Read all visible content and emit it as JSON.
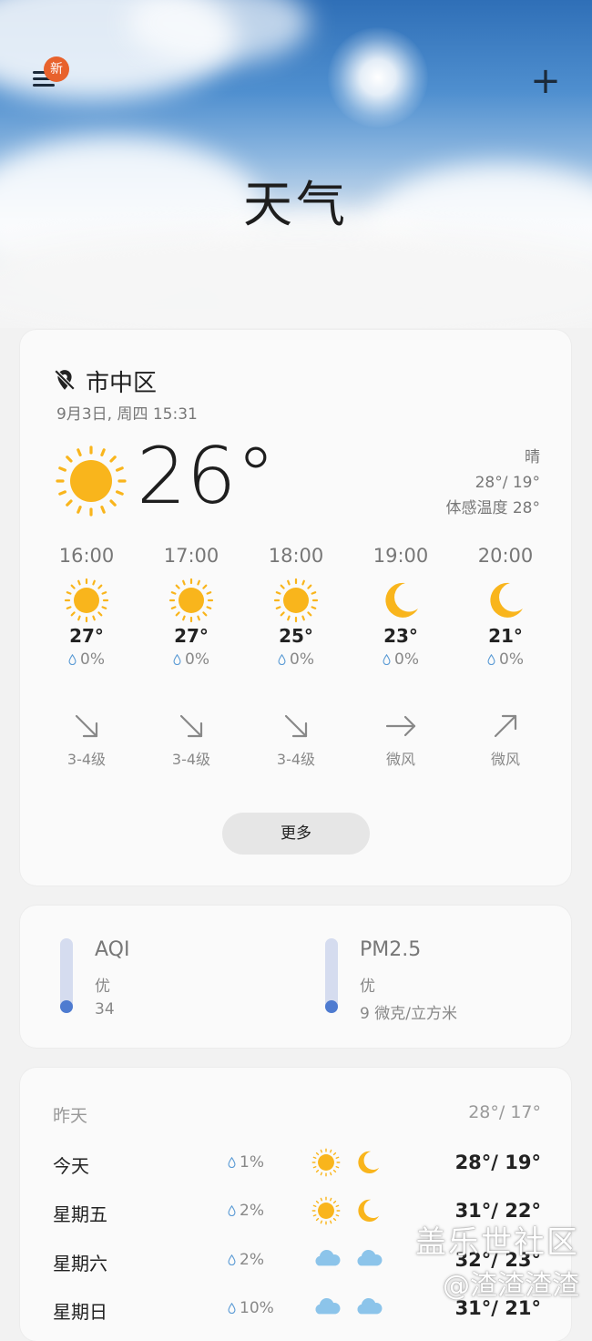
{
  "header": {
    "menu_icon": "hamburger-menu-icon",
    "badge": "新",
    "add_icon": "plus-icon",
    "add_symbol": "+",
    "title": "天气"
  },
  "current": {
    "location_icon": "location-off-icon",
    "location": "市中区",
    "datetime": "9月3日, 周四 15:31",
    "icon": "sun-icon",
    "temp": "26°",
    "condition": "晴",
    "high_low": "28°/ 19°",
    "feels_like": "体感温度 28°"
  },
  "hourly": [
    {
      "time": "16:00",
      "icon": "sun-icon",
      "temp": "27°",
      "rain": "0%",
      "wind_icon": "arrow-down-right-icon",
      "wind": "3-4级"
    },
    {
      "time": "17:00",
      "icon": "sun-icon",
      "temp": "27°",
      "rain": "0%",
      "wind_icon": "arrow-down-right-icon",
      "wind": "3-4级"
    },
    {
      "time": "18:00",
      "icon": "sun-icon",
      "temp": "25°",
      "rain": "0%",
      "wind_icon": "arrow-down-right-icon",
      "wind": "3-4级"
    },
    {
      "time": "19:00",
      "icon": "moon-icon",
      "temp": "23°",
      "rain": "0%",
      "wind_icon": "arrow-right-icon",
      "wind": "微风"
    },
    {
      "time": "20:00",
      "icon": "moon-icon",
      "temp": "21°",
      "rain": "0%",
      "wind_icon": "arrow-up-right-icon",
      "wind": "微风"
    }
  ],
  "more_button": "更多",
  "air_quality": [
    {
      "title": "AQI",
      "level": "优",
      "value": "34"
    },
    {
      "title": "PM2.5",
      "level": "优",
      "value": "9 微克/立方米"
    }
  ],
  "daily": [
    {
      "day": "昨天",
      "rain": "",
      "icons": [],
      "temp": "28°/ 17°"
    },
    {
      "day": "今天",
      "rain": "1%",
      "icons": [
        "sun-icon",
        "moon-icon"
      ],
      "temp": "28°/ 19°"
    },
    {
      "day": "星期五",
      "rain": "2%",
      "icons": [
        "sun-icon",
        "moon-icon"
      ],
      "temp": "31°/ 22°"
    },
    {
      "day": "星期六",
      "rain": "2%",
      "icons": [
        "cloud-icon",
        "cloud-icon"
      ],
      "temp": "32°/ 23°"
    },
    {
      "day": "星期日",
      "rain": "10%",
      "icons": [
        "cloud-icon",
        "cloud-icon"
      ],
      "temp": "31°/ 21°"
    }
  ],
  "watermark": {
    "line1": "盖乐世社区",
    "line2": "@渣渣渣渣"
  },
  "colors": {
    "sun": "#f9b51c",
    "aqi_bar": "#d5dcef",
    "aqi_dot": "#4e7bd0",
    "badge": "#e8622c",
    "cloud": "#8cc4ea"
  }
}
